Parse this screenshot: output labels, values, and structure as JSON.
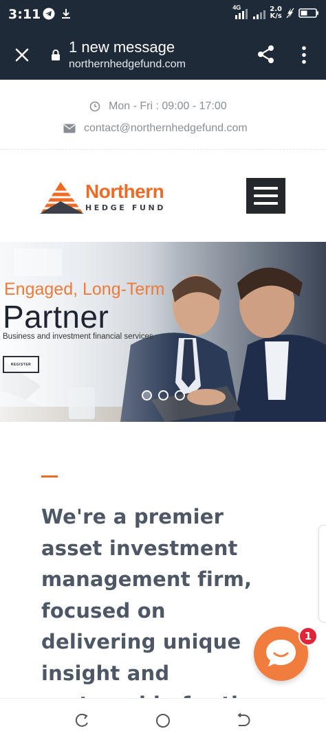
{
  "status_bar": {
    "time": "3:11",
    "network_type": "4G",
    "speed_value": "2.0",
    "speed_unit": "K/s",
    "icons": [
      "telegram-icon",
      "download-icon",
      "signal-icon",
      "signal-icon",
      "no-charge-icon",
      "battery-icon"
    ]
  },
  "toolbar": {
    "title": "1 new message",
    "url": "northernhedgefund.com",
    "icons": [
      "close-icon",
      "lock-icon",
      "share-icon",
      "more-vert-icon"
    ]
  },
  "info_bar": {
    "hours": "Mon - Fri : 09:00 - 17:00",
    "email": "contact@northernhedgefund.com",
    "icons": [
      "clock-icon",
      "envelope-icon"
    ]
  },
  "header": {
    "logo_name": "Northern",
    "logo_subtitle": "HEDGE FUND",
    "menu_icon": "hamburger-menu-icon"
  },
  "hero": {
    "kicker": "Engaged, Long-Term",
    "title": "Partner",
    "subtitle": "Business and investment financial services",
    "button_label": "REGISTER",
    "slides_count": 3,
    "active_slide": 1
  },
  "about": {
    "text": "We're a premier asset investment management firm, focused on delivering unique insight and partnership for the most sophisticated"
  },
  "chat": {
    "icon": "chat-bubble-icon",
    "badge_count": "1"
  },
  "colors": {
    "toolbar_bg": "#1f2a38",
    "brand_orange": "#ee6a25",
    "body_text": "#4d5766",
    "badge_red": "#e0253a",
    "chat_orange": "#f07c3e"
  },
  "nav_bar": {
    "icons": [
      "recents-icon",
      "home-icon",
      "back-icon"
    ]
  }
}
